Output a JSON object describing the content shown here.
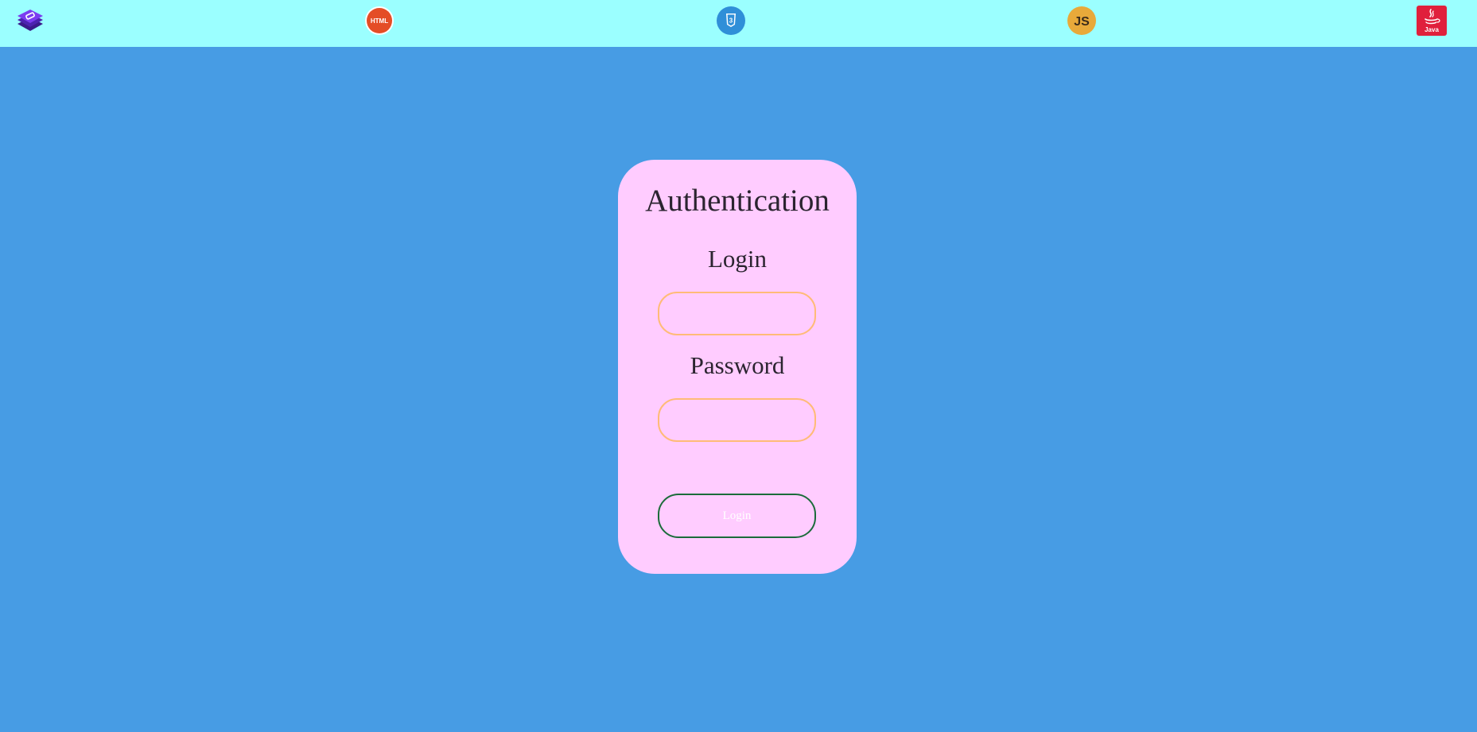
{
  "topbar": {
    "logos": [
      {
        "name": "app-logo"
      },
      {
        "name": "html5-logo",
        "text": "HTML"
      },
      {
        "name": "css3-logo",
        "text": "3"
      },
      {
        "name": "javascript-logo",
        "text": "JS"
      },
      {
        "name": "java-logo",
        "text": "Java"
      }
    ]
  },
  "card": {
    "title": "Authentication",
    "login_label": "Login",
    "login_value": "",
    "password_label": "Password",
    "password_value": "",
    "submit_label": "Login"
  },
  "colors": {
    "page_background": "#479ce4",
    "topbar_background": "#9bffff",
    "card_background": "#ffccff",
    "input_border": "#ffbb77",
    "button_border": "#1b6b3a",
    "html_logo": "#e44d26",
    "css_logo": "#2f8fd8",
    "js_logo": "#e8a93a",
    "java_logo": "#e0203c",
    "app_logo": "#6a2bd8"
  }
}
